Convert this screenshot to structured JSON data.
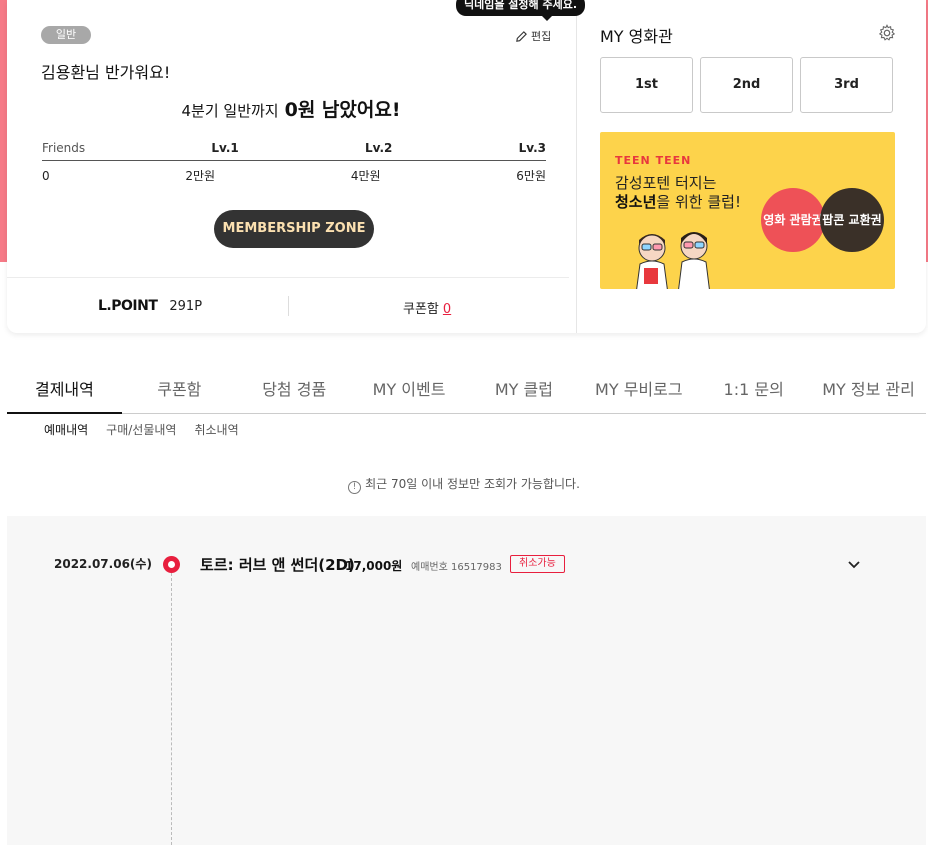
{
  "profile": {
    "grade_badge": "일반",
    "tooltip": "닉네임을 설정해 주세요.",
    "edit_label": "편집",
    "greeting": "김용환님 반가워요!",
    "remain_prefix": "4분기 일반까지",
    "remain_value": "0원 남았어요!"
  },
  "levels": {
    "headers": [
      "Friends",
      "Lv.1",
      "Lv.2",
      "Lv.3"
    ],
    "values": [
      "0",
      "2만원",
      "4만원",
      "6만원"
    ]
  },
  "membership_button": "MEMBERSHIP ZONE",
  "points": {
    "logo": "L.POINT",
    "value": "291P",
    "coupon_label": "쿠폰함",
    "coupon_count": "0"
  },
  "my_cinema": {
    "title": "MY 영화관",
    "slots": [
      "1st",
      "2nd",
      "3rd"
    ]
  },
  "banner": {
    "brand_a": "TEEN",
    "brand_b": "TEEN",
    "line1": "감성포텐 터지는",
    "line2_bold": "청소년",
    "line2_rest": "을 위한 클럽!",
    "circle1": "영화 관람권",
    "circle2": "팝콘 교환권"
  },
  "tabs": [
    "결제내역",
    "쿠폰함",
    "당첨 경품",
    "MY 이벤트",
    "MY 클럽",
    "MY 무비로그",
    "1:1 문의",
    "MY 정보 관리"
  ],
  "subtabs": [
    "예매내역",
    "구매/선물내역",
    "취소내역"
  ],
  "notice": "최근 70일 이내 정보만 조회가 가능합니다.",
  "history": {
    "date": "2022.07.06(수)",
    "movie": "토르: 러브 앤 썬더(2D)",
    "price": "17,000원",
    "reservation": "예매번호 16517983",
    "status": "취소가능"
  },
  "colors": {
    "accent": "#e81f3e",
    "top_background": "#f67a87",
    "banner": "#fdd34b"
  }
}
